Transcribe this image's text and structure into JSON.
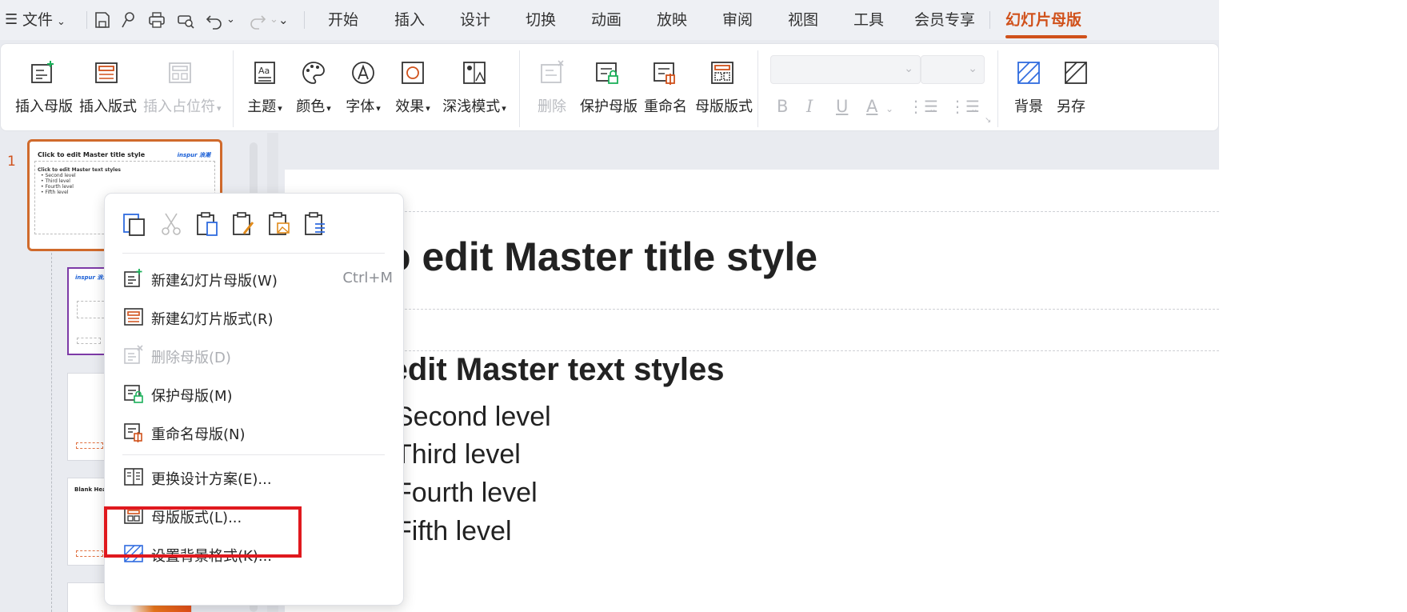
{
  "menu": {
    "file_label": "文件",
    "tabs": [
      {
        "label": "开始",
        "active": false
      },
      {
        "label": "插入",
        "active": false
      },
      {
        "label": "设计",
        "active": false
      },
      {
        "label": "切换",
        "active": false
      },
      {
        "label": "动画",
        "active": false
      },
      {
        "label": "放映",
        "active": false
      },
      {
        "label": "审阅",
        "active": false
      },
      {
        "label": "视图",
        "active": false
      },
      {
        "label": "工具",
        "active": false
      },
      {
        "label": "会员专享",
        "active": false
      },
      {
        "label": "幻灯片母版",
        "active": true
      }
    ],
    "accent_color": "#d0511b"
  },
  "ribbon": {
    "insert_master": "插入母版",
    "insert_layout": "插入版式",
    "insert_placeholder": "插入占位符",
    "theme": "主题",
    "colors": "颜色",
    "fonts": "字体",
    "effects": "效果",
    "dark_light": "深浅模式",
    "delete": "删除",
    "preserve_master": "保护母版",
    "rename": "重命名",
    "master_layout": "母版版式",
    "bold": "B",
    "italic": "I",
    "underline": "U",
    "font_color": "A",
    "background": "背景",
    "save_as": "另存"
  },
  "thumbnails": {
    "slide_number": "1",
    "master_title": "Click to edit Master title style",
    "master_logo": "inspur 浪潮",
    "master_text": [
      "Click to edit Master text styles",
      "• Second level",
      "• Third level",
      "• Fourth level",
      "• Fifth level"
    ],
    "layout_logo": "inspur 浪潮",
    "blank_header": "Blank Header"
  },
  "slide": {
    "title": "Click to edit Master title style",
    "level1": "Click to edit Master text styles",
    "level2": "Second level",
    "level3": "Third level",
    "level4": "Fourth level",
    "level5": "Fifth level"
  },
  "context_menu": {
    "items": [
      {
        "label": "新建幻灯片母版(W)",
        "shortcut": "Ctrl+M",
        "enabled": true
      },
      {
        "label": "新建幻灯片版式(R)",
        "shortcut": "",
        "enabled": true
      },
      {
        "label": "删除母版(D)",
        "shortcut": "",
        "enabled": false
      },
      {
        "label": "保护母版(M)",
        "shortcut": "",
        "enabled": true
      },
      {
        "label": "重命名母版(N)",
        "shortcut": "",
        "enabled": true
      },
      {
        "label": "更换设计方案(E)...",
        "shortcut": "",
        "enabled": true
      },
      {
        "label": "母版版式(L)...",
        "shortcut": "",
        "enabled": true,
        "highlighted": true
      },
      {
        "label": "设置背景格式(K)...",
        "shortcut": "",
        "enabled": true
      }
    ],
    "highlight_color": "#e0191e"
  }
}
